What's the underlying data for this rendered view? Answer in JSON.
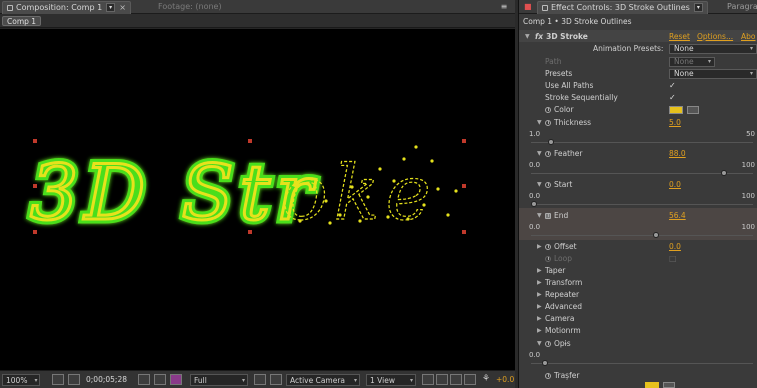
{
  "comp_panel": {
    "tab_active": "Composition: Comp 1",
    "tab_inactive": "Footage: (none)",
    "comp_chip": "Comp 1",
    "footer": {
      "zoom": "100%",
      "timecode": "0;00;05;28",
      "resolution": "Full",
      "camera": "Active Camera",
      "view": "1 View",
      "exposure": "+0.0"
    }
  },
  "fx_panel": {
    "tab_active": "Effect Controls: 3D Stroke Outlines",
    "tab_inactive": "Paragra",
    "breadcrumb": "Comp 1 • 3D Stroke Outlines",
    "effect": {
      "fx_label": "fx",
      "name": "3D Stroke",
      "reset": "Reset",
      "options": "Options...",
      "about": "Abo"
    },
    "animation_presets_label": "Animation Presets:",
    "animation_presets_value": "None",
    "path_label": "Path",
    "path_value": "None",
    "presets_label": "Presets",
    "presets_value": "None",
    "use_all_paths_label": "Use All Paths",
    "stroke_seq_label": "Stroke Sequentially",
    "color_label": "Color",
    "thickness": {
      "label": "Thickness",
      "value": "5.0",
      "min": "1.0",
      "max": "50"
    },
    "feather": {
      "label": "Feather",
      "value": "88.0",
      "min": "0.0",
      "max": "100"
    },
    "start": {
      "label": "Start",
      "value": "0.0",
      "min": "0.0",
      "max": "100"
    },
    "end": {
      "label": "End",
      "value": "56.4",
      "min": "0.0",
      "max": "100"
    },
    "offset": {
      "label": "Offset",
      "value": "0.0"
    },
    "loop_label": "Loop",
    "groups": [
      "Taper",
      "Transform",
      "Repeater",
      "Advanced",
      "Camera",
      "Motionrm"
    ],
    "opacity": {
      "label": "Opɨs",
      "min": "0.0"
    },
    "transfer_label": "Trașfer"
  },
  "sliders": {
    "thickness": 0.08,
    "feather": 0.88,
    "start": 0.0,
    "end": 0.564,
    "opacity": 0.05
  },
  "colors": {
    "stroke": "#e6e21c",
    "glow": "#4ade1a",
    "accent": "#e0a020",
    "swatch": "#e6c11c"
  },
  "viewer_text": "3D Stroke"
}
